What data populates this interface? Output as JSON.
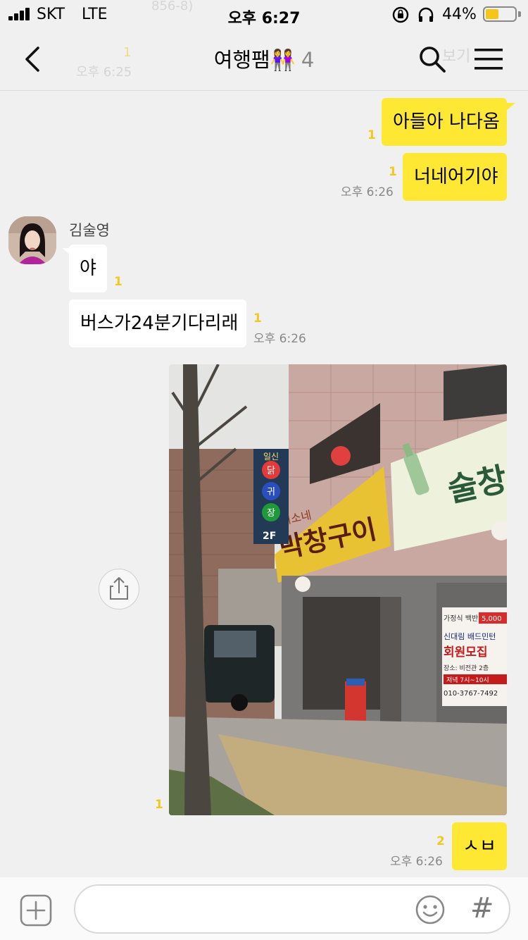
{
  "status_bar": {
    "carrier": "SKT",
    "network": "LTE",
    "time": "오후 6:27",
    "battery": "44%",
    "battery_level": 0.44
  },
  "header": {
    "title": "여행팸",
    "title_emoji": "👭",
    "member_count": "4",
    "ghost_top": "856-8)",
    "ghost_time": "오후 6:25",
    "ghost_unread": "1",
    "ghost_right": "보기"
  },
  "messages": {
    "m1": {
      "text": "아들아 나다옴",
      "unread": "1"
    },
    "m2": {
      "text": "너네어기야",
      "unread": "1",
      "time": "오후 6:26"
    },
    "sender": {
      "name": "김술영"
    },
    "m3": {
      "text": "야",
      "unread": "1"
    },
    "m4": {
      "text": "버스가24분기다리래",
      "unread": "1",
      "time": "오후 6:26"
    },
    "photo": {
      "unread": "1",
      "sign_left_top": "미소네",
      "sign_left_main": "막창구이",
      "sign_right_main": "술창",
      "poster_line1": "가정식 백반",
      "poster_price": "5,000",
      "poster_line2": "신대림 배드민턴",
      "poster_line3": "회원모집",
      "poster_line4": "장소: 비전관 2층",
      "poster_line5": "저녁 7시~10시",
      "poster_phone": "010-3767-7492",
      "side_sign": "2F",
      "side_sign_top": "일신",
      "side_sign_c1": "닭",
      "side_sign_c2": "귀",
      "side_sign_c3": "장"
    },
    "m5": {
      "text": "ㅅㅂ",
      "unread": "2",
      "time": "오후 6:26"
    }
  },
  "input": {
    "placeholder": "",
    "hash": "#"
  },
  "colors": {
    "my_bubble": "#fee833",
    "other_bubble": "#ffffff",
    "background": "#f0f0f0",
    "unread": "#f2c81e"
  }
}
